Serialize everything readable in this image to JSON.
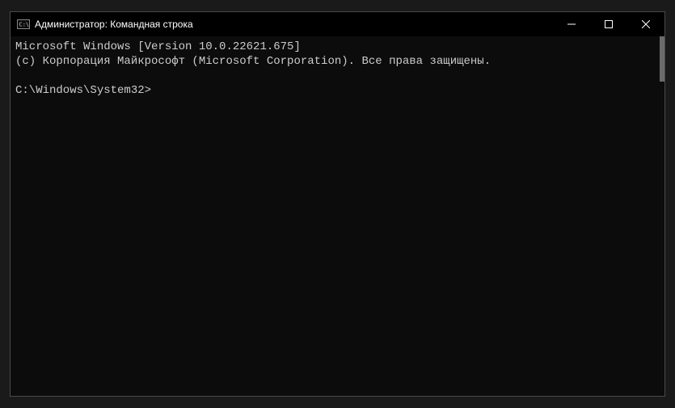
{
  "titlebar": {
    "title": "Администратор: Командная строка"
  },
  "terminal": {
    "line1": "Microsoft Windows [Version 10.0.22621.675]",
    "line2": "(c) Корпорация Майкрософт (Microsoft Corporation). Все права защищены.",
    "blank": "",
    "prompt": "C:\\Windows\\System32>"
  }
}
